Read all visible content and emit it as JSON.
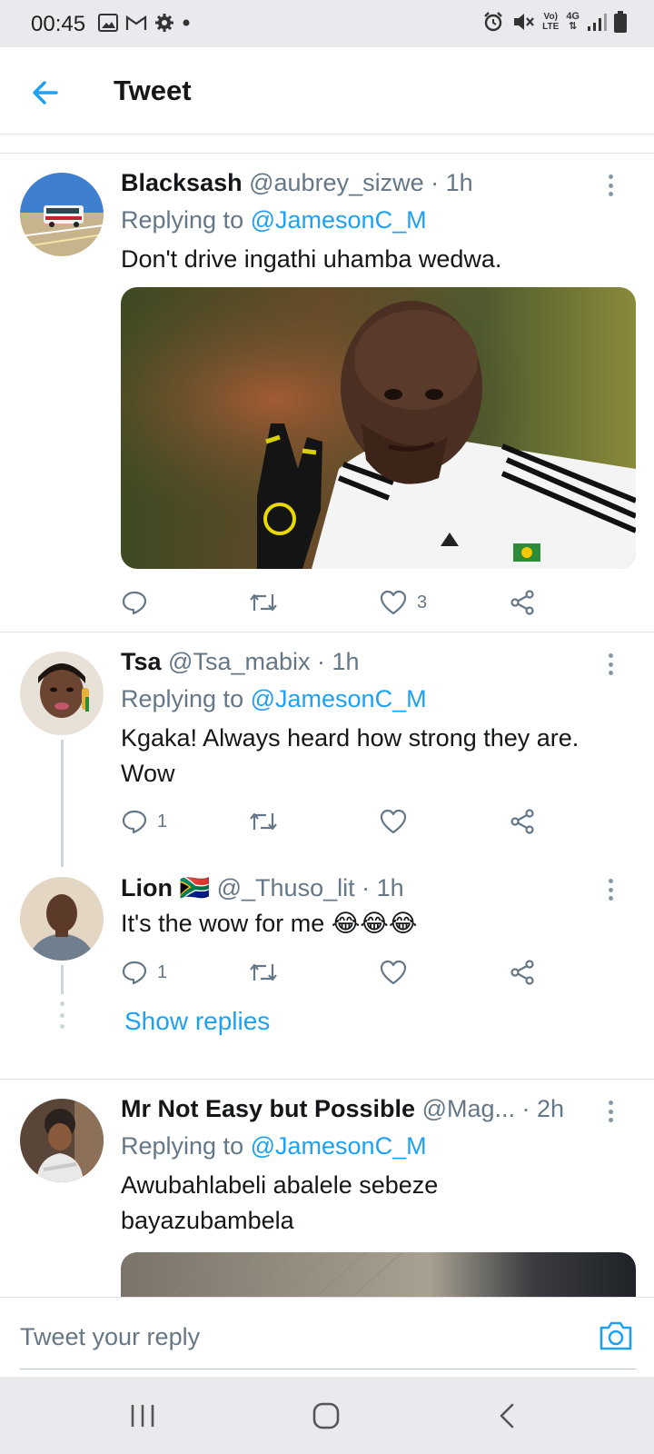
{
  "status_bar": {
    "time": "00:45",
    "left_icons": [
      "image-icon",
      "gmail-icon",
      "gear-icon",
      "dot-icon"
    ],
    "right_icons": [
      "alarm-icon",
      "mute-icon",
      "volte-icon",
      "4g-icon",
      "signal-icon",
      "battery-icon"
    ],
    "volte_label_top": "Vo)",
    "volte_label_bottom": "LTE",
    "network_label": "4G"
  },
  "header": {
    "back_icon": "arrow-left-icon",
    "title": "Tweet"
  },
  "tweets": [
    {
      "display_name": "Blacksash",
      "handle": "@aubrey_sizwe",
      "time": "· 1h",
      "replying_prefix": "Replying to",
      "replying_to": "@JamesonC_M",
      "text": "Don't drive ingathi uhamba wedwa.",
      "likes": "3",
      "has_media": true
    },
    {
      "display_name": "Tsa",
      "handle": "@Tsa_mabix",
      "time": "· 1h",
      "replying_prefix": "Replying to",
      "replying_to": "@JamesonC_M",
      "text": "Kgaka! Always heard how strong they are. Wow",
      "replies": "1"
    },
    {
      "display_name": "Lion 🇿🇦",
      "handle": "@_Thuso_lit",
      "time": "· 1h",
      "text": "It's the wow for me 😂😂😂",
      "replies": "1"
    },
    {
      "display_name": "Mr Not Easy but Possible",
      "handle": "@Mag...",
      "time": "· 2h",
      "replying_prefix": "Replying to",
      "replying_to": "@JamesonC_M",
      "text": "Awubahlabeli abalele sebeze bayazubambela"
    }
  ],
  "show_replies_label": "Show replies",
  "reply_box": {
    "placeholder": "Tweet your reply",
    "camera_icon": "camera-icon"
  },
  "nav_bar": {
    "buttons": [
      "recents-icon",
      "home-icon",
      "back-icon"
    ]
  },
  "colors": {
    "accent": "#1da1f2",
    "secondary_text": "#657786",
    "primary_text": "#14171a",
    "status_bar_bg": "#e9eaee"
  }
}
